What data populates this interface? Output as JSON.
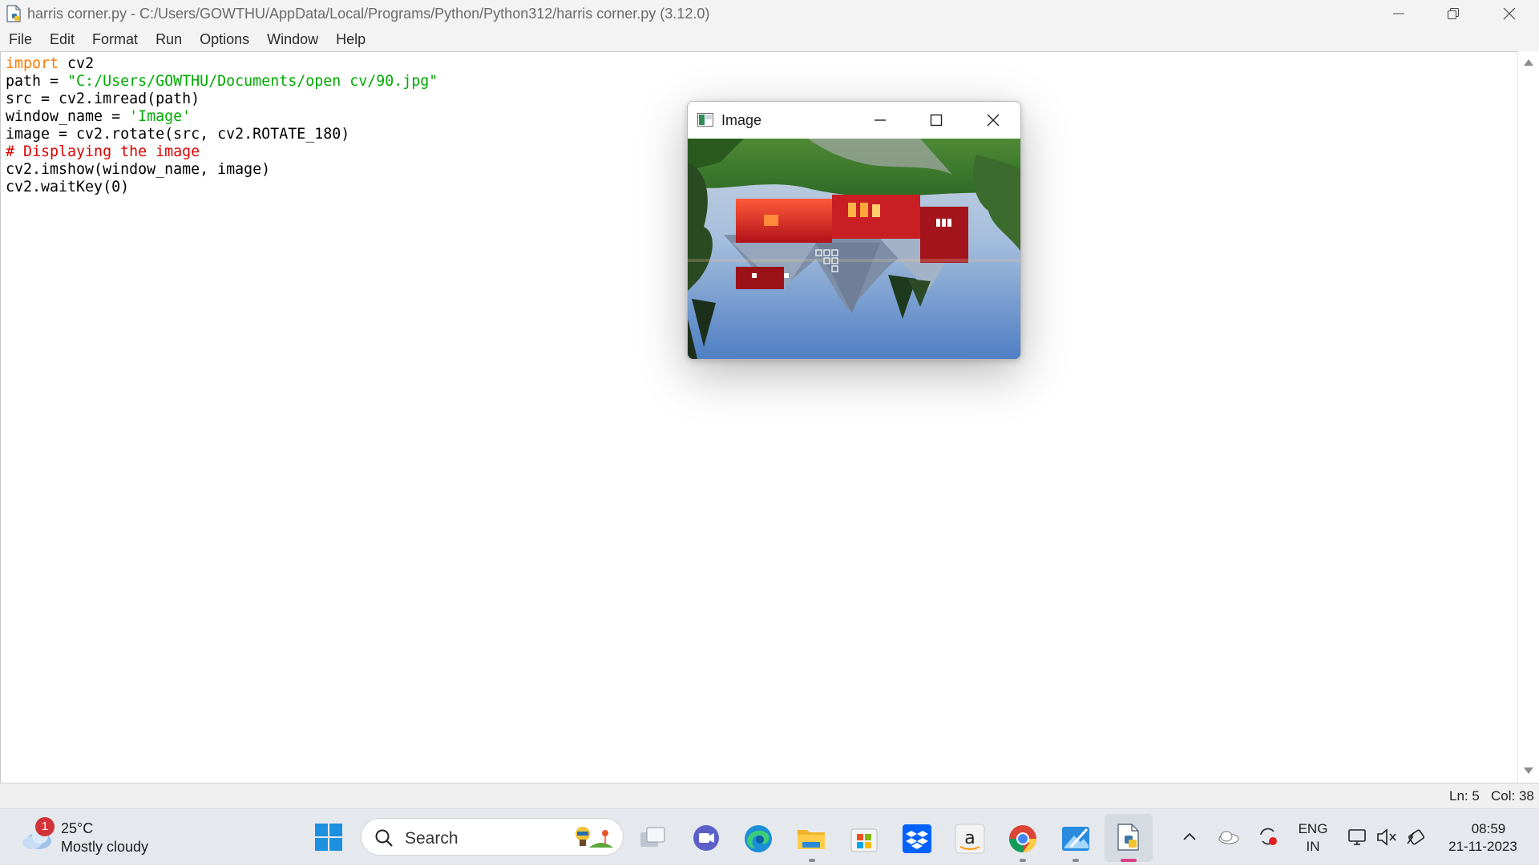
{
  "window": {
    "title": "harris corner.py - C:/Users/GOWTHU/AppData/Local/Programs/Python/Python312/harris corner.py (3.12.0)"
  },
  "menu": [
    "File",
    "Edit",
    "Format",
    "Run",
    "Options",
    "Window",
    "Help"
  ],
  "code_lines": [
    [
      {
        "t": "import",
        "c": "kw"
      },
      {
        "t": " cv2",
        "c": ""
      }
    ],
    [
      {
        "t": "path = ",
        "c": ""
      },
      {
        "t": "\"C:/Users/GOWTHU/Documents/open cv/90.jpg\"",
        "c": "str"
      }
    ],
    [
      {
        "t": "src = cv2.imread(path)",
        "c": ""
      }
    ],
    [
      {
        "t": "window_name = ",
        "c": ""
      },
      {
        "t": "'Image'",
        "c": "str"
      }
    ],
    [
      {
        "t": "image = cv2.rotate(src, cv2.ROTATE_180)",
        "c": ""
      }
    ],
    [
      {
        "t": "# Displaying the image",
        "c": "cmt"
      }
    ],
    [
      {
        "t": "cv2.imshow(window_name, image)",
        "c": ""
      }
    ],
    [
      {
        "t": "cv2.waitKey(0)",
        "c": ""
      }
    ]
  ],
  "status": {
    "line": "Ln: 5",
    "col": "Col: 38"
  },
  "image_window": {
    "title": "Image"
  },
  "taskbar": {
    "weather_badge": "1",
    "temperature": "25°C",
    "condition": "Mostly cloudy",
    "search_label": "Search",
    "lang_primary": "ENG",
    "lang_secondary": "IN",
    "time": "08:59",
    "date": "21-11-2023"
  },
  "colors": {
    "keyword": "#ff7700",
    "string": "#00aa00",
    "comment": "#dd0000"
  }
}
